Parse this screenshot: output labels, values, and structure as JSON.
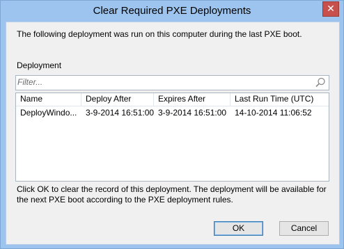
{
  "window": {
    "title": "Clear Required PXE Deployments",
    "close_glyph": "✕"
  },
  "intro_text": "The following deployment was run on this computer during the last PXE boot.",
  "deployment_label": "Deployment",
  "filter": {
    "placeholder": "Filter...",
    "value": ""
  },
  "table": {
    "columns": [
      "Name",
      "Deploy After",
      "Expires After",
      "Last Run Time (UTC)"
    ],
    "rows": [
      [
        "DeployWindo...",
        "3-9-2014 16:51:00",
        "3-9-2014 16:51:00",
        "14-10-2014 11:06:52"
      ]
    ]
  },
  "footer_text": "Click OK to clear the record of this deployment. The deployment will be available for the next PXE boot according to the PXE deployment rules.",
  "buttons": {
    "ok": "OK",
    "cancel": "Cancel"
  },
  "colors": {
    "title_bar": "#9cc4ee",
    "close_button": "#c7504c"
  }
}
